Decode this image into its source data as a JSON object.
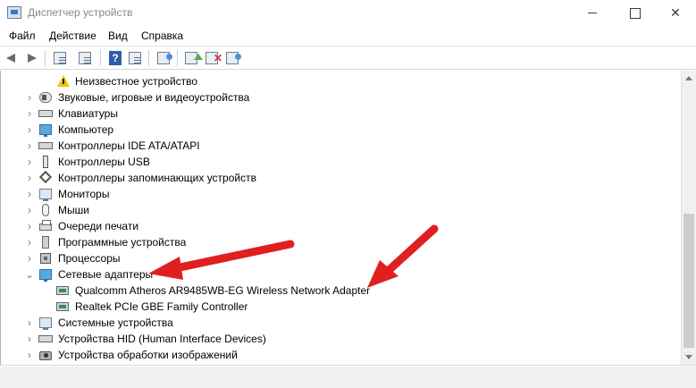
{
  "window": {
    "title": "Диспетчер устройств"
  },
  "menu": {
    "file": "Файл",
    "action": "Действие",
    "view": "Вид",
    "help": "Справка"
  },
  "toolbar": {
    "icons": [
      "back-arrow-icon",
      "forward-arrow-icon",
      "properties-icon",
      "list-icon",
      "help-icon",
      "details-icon",
      "scan-hardware-icon",
      "update-driver-icon",
      "uninstall-device-icon",
      "enable-device-icon"
    ]
  },
  "tree": {
    "items": [
      {
        "label": "Неизвестное устройство",
        "icon": "warning-icon",
        "expanded": false,
        "level": 1
      },
      {
        "label": "Звуковые, игровые и видеоустройства",
        "icon": "speaker-icon",
        "expanded": false,
        "level": 0
      },
      {
        "label": "Клавиатуры",
        "icon": "keyboard-icon",
        "expanded": false,
        "level": 0
      },
      {
        "label": "Компьютер",
        "icon": "computer-icon",
        "expanded": false,
        "level": 0
      },
      {
        "label": "Контроллеры IDE ATA/ATAPI",
        "icon": "ide-controller-icon",
        "expanded": false,
        "level": 0
      },
      {
        "label": "Контроллеры USB",
        "icon": "usb-icon",
        "expanded": false,
        "level": 0
      },
      {
        "label": "Контроллеры запоминающих устройств",
        "icon": "storage-controller-icon",
        "expanded": false,
        "level": 0
      },
      {
        "label": "Мониторы",
        "icon": "monitor-icon",
        "expanded": false,
        "level": 0
      },
      {
        "label": "Мыши",
        "icon": "mouse-icon",
        "expanded": false,
        "level": 0
      },
      {
        "label": "Очереди печати",
        "icon": "printer-icon",
        "expanded": false,
        "level": 0
      },
      {
        "label": "Программные устройства",
        "icon": "software-device-icon",
        "expanded": false,
        "level": 0
      },
      {
        "label": "Процессоры",
        "icon": "processor-icon",
        "expanded": false,
        "level": 0
      },
      {
        "label": "Сетевые адаптеры",
        "icon": "network-adapter-icon",
        "expanded": true,
        "level": 0
      },
      {
        "label": "Qualcomm Atheros AR9485WB-EG Wireless Network Adapter",
        "icon": "network-adapter-icon",
        "expanded": false,
        "level": 1
      },
      {
        "label": "Realtek PCIe GBE Family Controller",
        "icon": "network-adapter-icon",
        "expanded": false,
        "level": 1
      },
      {
        "label": "Системные устройства",
        "icon": "system-device-icon",
        "expanded": false,
        "level": 0
      },
      {
        "label": "Устройства HID (Human Interface Devices)",
        "icon": "hid-device-icon",
        "expanded": false,
        "level": 0
      },
      {
        "label": "Устройства обработки изображений",
        "icon": "camera-icon",
        "expanded": false,
        "level": 0
      }
    ]
  },
  "colors": {
    "annotation_arrow": "#e02020"
  }
}
